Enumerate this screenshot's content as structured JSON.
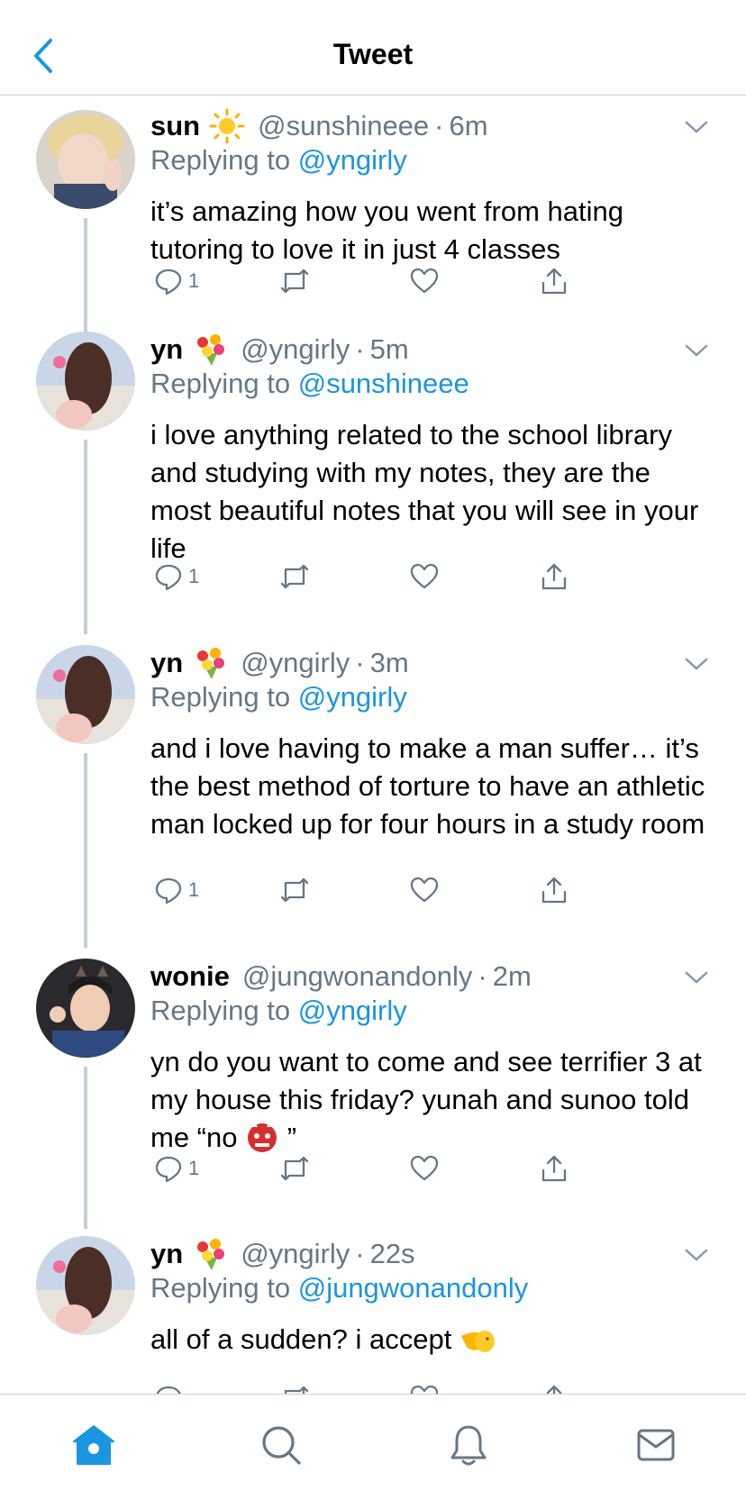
{
  "header": {
    "title": "Tweet",
    "back_icon": "chevron-left-icon"
  },
  "colors": {
    "accent": "#1b95e0",
    "muted": "#657786",
    "divider": "#c7d0d8"
  },
  "tweets": [
    {
      "name": "sun",
      "emoji": "sun-emoji",
      "handle": "@sunshineee",
      "time": "6m",
      "replying_prefix": "Replying to",
      "replying_to": "@yngirly",
      "text": "it’s amazing how you went from hating tutoring to love it in just 4 classes",
      "reply_count": "1"
    },
    {
      "name": "yn",
      "emoji": "bouquet-emoji",
      "handle": "@yngirly",
      "time": "5m",
      "replying_prefix": "Replying to",
      "replying_to": "@sunshineee",
      "text": "i love anything related to the school library and studying with my notes, they are the most beautiful notes that you will see in your life",
      "reply_count": "1"
    },
    {
      "name": "yn",
      "emoji": "bouquet-emoji",
      "handle": "@yngirly",
      "time": "3m",
      "replying_prefix": "Replying to",
      "replying_to": "@yngirly",
      "text": "and i love having to make a man suffer… it’s the best method of torture to have an athletic man locked up for four hours in a study room",
      "reply_count": "1"
    },
    {
      "name": "wonie",
      "emoji": "",
      "handle": "@jungwonandonly",
      "time": "2m",
      "replying_prefix": "Replying to",
      "replying_to": "@yngirly",
      "text_before": "yn do you want to come and see terrifier 3 at my house this friday? yunah and sunoo told me “no",
      "text_after": "”",
      "inline_emoji": "ogre-emoji",
      "reply_count": "1"
    },
    {
      "name": "yn",
      "emoji": "bouquet-emoji",
      "handle": "@yngirly",
      "time": "22s",
      "replying_prefix": "Replying to",
      "replying_to": "@jungwonandonly",
      "text": "all of a sudden? i accept",
      "inline_emoji": "pointing-hand-emoji"
    }
  ],
  "action_icons": [
    "reply-icon",
    "retweet-icon",
    "like-icon",
    "share-icon"
  ],
  "tabbar": {
    "items": [
      "home-icon",
      "search-icon",
      "notifications-icon",
      "messages-icon"
    ],
    "active": "home-icon"
  }
}
